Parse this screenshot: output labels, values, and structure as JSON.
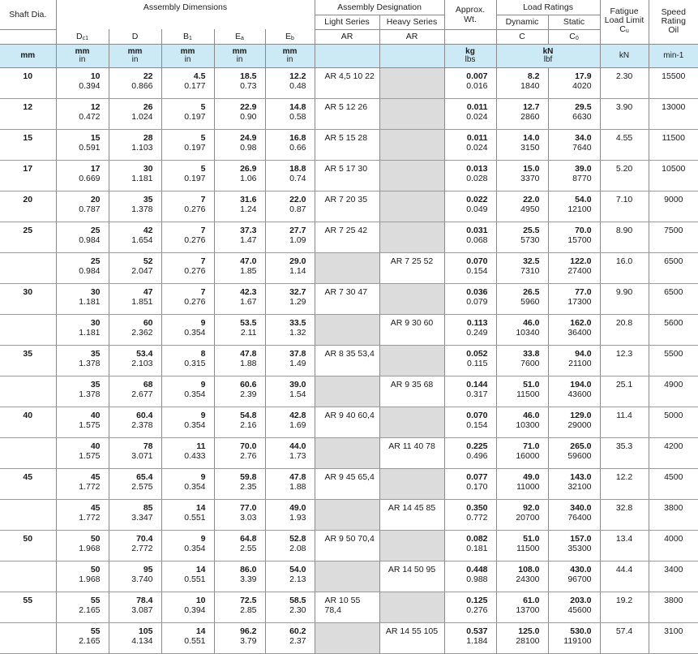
{
  "headers": {
    "shaft_dia": "Shaft Dia.",
    "assembly_dimensions": "Assembly Dimensions",
    "assembly_designation": "Assembly Designation",
    "light_series": "Light Series",
    "heavy_series": "Heavy Series",
    "approx_wt": "Approx. Wt.",
    "load_ratings": "Load Ratings",
    "dynamic": "Dynamic",
    "static": "Static",
    "fatigue_load_limit": "Fatigue Load Limit",
    "fatigue_symbol": "Cu",
    "speed_rating": "Speed Rating",
    "oil": "Oil"
  },
  "symbols": {
    "dc1": "Dc1",
    "d": "D",
    "b1": "B1",
    "ea": "Ea",
    "eb": "Eb",
    "ar_light": "AR",
    "ar_heavy": "AR",
    "c": "C",
    "c0": "C0"
  },
  "units": {
    "shaft": "mm",
    "dim_metric": "mm",
    "dim_inch": "in",
    "wt_metric": "kg",
    "wt_imperial": "lbs",
    "load_metric": "kN",
    "load_imperial": "lbf",
    "fatigue": "kN",
    "speed": "min-1"
  },
  "rows": [
    {
      "shaft": "10",
      "dc1": [
        "10",
        "0.394"
      ],
      "d": [
        "22",
        "0.866"
      ],
      "b1": [
        "4.5",
        "0.177"
      ],
      "ea": [
        "18.5",
        "0.73"
      ],
      "eb": [
        "12.2",
        "0.48"
      ],
      "light": "AR 4,5 10 22",
      "heavy": "",
      "wt": [
        "0.007",
        "0.016"
      ],
      "c": [
        "8.2",
        "1840"
      ],
      "c0": [
        "17.9",
        "4020"
      ],
      "cu": "2.30",
      "speed": "15500"
    },
    {
      "shaft": "12",
      "dc1": [
        "12",
        "0.472"
      ],
      "d": [
        "26",
        "1.024"
      ],
      "b1": [
        "5",
        "0.197"
      ],
      "ea": [
        "22.9",
        "0.90"
      ],
      "eb": [
        "14.8",
        "0.58"
      ],
      "light": "AR 5 12 26",
      "heavy": "",
      "wt": [
        "0.011",
        "0.024"
      ],
      "c": [
        "12.7",
        "2860"
      ],
      "c0": [
        "29.5",
        "6630"
      ],
      "cu": "3.90",
      "speed": "13000"
    },
    {
      "shaft": "15",
      "dc1": [
        "15",
        "0.591"
      ],
      "d": [
        "28",
        "1.103"
      ],
      "b1": [
        "5",
        "0.197"
      ],
      "ea": [
        "24.9",
        "0.98"
      ],
      "eb": [
        "16.8",
        "0.66"
      ],
      "light": "AR 5 15 28",
      "heavy": "",
      "wt": [
        "0.011",
        "0.024"
      ],
      "c": [
        "14.0",
        "3150"
      ],
      "c0": [
        "34.0",
        "7640"
      ],
      "cu": "4.55",
      "speed": "11500"
    },
    {
      "shaft": "17",
      "dc1": [
        "17",
        "0.669"
      ],
      "d": [
        "30",
        "1.181"
      ],
      "b1": [
        "5",
        "0.197"
      ],
      "ea": [
        "26.9",
        "1.06"
      ],
      "eb": [
        "18.8",
        "0.74"
      ],
      "light": "AR 5 17 30",
      "heavy": "",
      "wt": [
        "0.013",
        "0.028"
      ],
      "c": [
        "15.0",
        "3370"
      ],
      "c0": [
        "39.0",
        "8770"
      ],
      "cu": "5.20",
      "speed": "10500"
    },
    {
      "shaft": "20",
      "dc1": [
        "20",
        "0.787"
      ],
      "d": [
        "35",
        "1.378"
      ],
      "b1": [
        "7",
        "0.276"
      ],
      "ea": [
        "31.6",
        "1.24"
      ],
      "eb": [
        "22.0",
        "0.87"
      ],
      "light": "AR 7 20 35",
      "heavy": "",
      "wt": [
        "0.022",
        "0.049"
      ],
      "c": [
        "22.0",
        "4950"
      ],
      "c0": [
        "54.0",
        "12100"
      ],
      "cu": "7.10",
      "speed": "9000"
    },
    {
      "shaft": "25",
      "dc1": [
        "25",
        "0.984"
      ],
      "d": [
        "42",
        "1.654"
      ],
      "b1": [
        "7",
        "0.276"
      ],
      "ea": [
        "37.3",
        "1.47"
      ],
      "eb": [
        "27.7",
        "1.09"
      ],
      "light": "AR 7 25 42",
      "heavy": "",
      "wt": [
        "0.031",
        "0.068"
      ],
      "c": [
        "25.5",
        "5730"
      ],
      "c0": [
        "70.0",
        "15700"
      ],
      "cu": "8.90",
      "speed": "7500"
    },
    {
      "shaft": "",
      "dc1": [
        "25",
        "0.984"
      ],
      "d": [
        "52",
        "2.047"
      ],
      "b1": [
        "7",
        "0.276"
      ],
      "ea": [
        "47.0",
        "1.85"
      ],
      "eb": [
        "29.0",
        "1.14"
      ],
      "light": "",
      "heavy": "AR 7 25 52",
      "wt": [
        "0.070",
        "0.154"
      ],
      "c": [
        "32.5",
        "7310"
      ],
      "c0": [
        "122.0",
        "27400"
      ],
      "cu": "16.0",
      "speed": "6500"
    },
    {
      "shaft": "30",
      "dc1": [
        "30",
        "1.181"
      ],
      "d": [
        "47",
        "1.851"
      ],
      "b1": [
        "7",
        "0.276"
      ],
      "ea": [
        "42.3",
        "1.67"
      ],
      "eb": [
        "32.7",
        "1.29"
      ],
      "light": "AR 7 30 47",
      "heavy": "",
      "wt": [
        "0.036",
        "0.079"
      ],
      "c": [
        "26.5",
        "5960"
      ],
      "c0": [
        "77.0",
        "17300"
      ],
      "cu": "9.90",
      "speed": "6500"
    },
    {
      "shaft": "",
      "dc1": [
        "30",
        "1.181"
      ],
      "d": [
        "60",
        "2.362"
      ],
      "b1": [
        "9",
        "0.354"
      ],
      "ea": [
        "53.5",
        "2.11"
      ],
      "eb": [
        "33.5",
        "1.32"
      ],
      "light": "",
      "heavy": "AR 9 30 60",
      "wt": [
        "0.113",
        "0.249"
      ],
      "c": [
        "46.0",
        "10340"
      ],
      "c0": [
        "162.0",
        "36400"
      ],
      "cu": "20.8",
      "speed": "5600"
    },
    {
      "shaft": "35",
      "dc1": [
        "35",
        "1.378"
      ],
      "d": [
        "53.4",
        "2.103"
      ],
      "b1": [
        "8",
        "0.315"
      ],
      "ea": [
        "47.8",
        "1.88"
      ],
      "eb": [
        "37.8",
        "1.49"
      ],
      "light": "AR 8 35 53,4",
      "heavy": "",
      "wt": [
        "0.052",
        "0.115"
      ],
      "c": [
        "33.8",
        "7600"
      ],
      "c0": [
        "94.0",
        "21100"
      ],
      "cu": "12.3",
      "speed": "5500"
    },
    {
      "shaft": "",
      "dc1": [
        "35",
        "1.378"
      ],
      "d": [
        "68",
        "2.677"
      ],
      "b1": [
        "9",
        "0.354"
      ],
      "ea": [
        "60.6",
        "2.39"
      ],
      "eb": [
        "39.0",
        "1.54"
      ],
      "light": "",
      "heavy": "AR 9 35 68",
      "wt": [
        "0.144",
        "0.317"
      ],
      "c": [
        "51.0",
        "11500"
      ],
      "c0": [
        "194.0",
        "43600"
      ],
      "cu": "25.1",
      "speed": "4900"
    },
    {
      "shaft": "40",
      "dc1": [
        "40",
        "1.575"
      ],
      "d": [
        "60.4",
        "2.378"
      ],
      "b1": [
        "9",
        "0.354"
      ],
      "ea": [
        "54.8",
        "2.16"
      ],
      "eb": [
        "42.8",
        "1.69"
      ],
      "light": "AR 9 40 60,4",
      "heavy": "",
      "wt": [
        "0.070",
        "0.154"
      ],
      "c": [
        "46.0",
        "10300"
      ],
      "c0": [
        "129.0",
        "29000"
      ],
      "cu": "11.4",
      "speed": "5000"
    },
    {
      "shaft": "",
      "dc1": [
        "40",
        "1.575"
      ],
      "d": [
        "78",
        "3.071"
      ],
      "b1": [
        "11",
        "0.433"
      ],
      "ea": [
        "70.0",
        "2.76"
      ],
      "eb": [
        "44.0",
        "1.73"
      ],
      "light": "",
      "heavy": "AR 11 40 78",
      "wt": [
        "0.225",
        "0.496"
      ],
      "c": [
        "71.0",
        "16000"
      ],
      "c0": [
        "265.0",
        "59600"
      ],
      "cu": "35.3",
      "speed": "4200"
    },
    {
      "shaft": "45",
      "dc1": [
        "45",
        "1.772"
      ],
      "d": [
        "65.4",
        "2.575"
      ],
      "b1": [
        "9",
        "0.354"
      ],
      "ea": [
        "59.8",
        "2.35"
      ],
      "eb": [
        "47.8",
        "1.88"
      ],
      "light": "AR 9 45 65,4",
      "heavy": "",
      "wt": [
        "0.077",
        "0.170"
      ],
      "c": [
        "49.0",
        "11000"
      ],
      "c0": [
        "143.0",
        "32100"
      ],
      "cu": "12.2",
      "speed": "4500"
    },
    {
      "shaft": "",
      "dc1": [
        "45",
        "1.772"
      ],
      "d": [
        "85",
        "3.347"
      ],
      "b1": [
        "14",
        "0.551"
      ],
      "ea": [
        "77.0",
        "3.03"
      ],
      "eb": [
        "49.0",
        "1.93"
      ],
      "light": "",
      "heavy": "AR 14 45 85",
      "wt": [
        "0.350",
        "0.772"
      ],
      "c": [
        "92.0",
        "20700"
      ],
      "c0": [
        "340.0",
        "76400"
      ],
      "cu": "32.8",
      "speed": "3800"
    },
    {
      "shaft": "50",
      "dc1": [
        "50",
        "1.968"
      ],
      "d": [
        "70.4",
        "2.772"
      ],
      "b1": [
        "9",
        "0.354"
      ],
      "ea": [
        "64.8",
        "2.55"
      ],
      "eb": [
        "52.8",
        "2.08"
      ],
      "light": "AR 9 50 70,4",
      "heavy": "",
      "wt": [
        "0.082",
        "0.181"
      ],
      "c": [
        "51.0",
        "11500"
      ],
      "c0": [
        "157.0",
        "35300"
      ],
      "cu": "13.4",
      "speed": "4000"
    },
    {
      "shaft": "",
      "dc1": [
        "50",
        "1.968"
      ],
      "d": [
        "95",
        "3.740"
      ],
      "b1": [
        "14",
        "0.551"
      ],
      "ea": [
        "86.0",
        "3.39"
      ],
      "eb": [
        "54.0",
        "2.13"
      ],
      "light": "",
      "heavy": "AR 14 50 95",
      "wt": [
        "0.448",
        "0.988"
      ],
      "c": [
        "108.0",
        "24300"
      ],
      "c0": [
        "430.0",
        "96700"
      ],
      "cu": "44.4",
      "speed": "3400"
    },
    {
      "shaft": "55",
      "dc1": [
        "55",
        "2.165"
      ],
      "d": [
        "78.4",
        "3.087"
      ],
      "b1": [
        "10",
        "0.394"
      ],
      "ea": [
        "72.5",
        "2.85"
      ],
      "eb": [
        "58.5",
        "2.30"
      ],
      "light": "AR 10 55 78,4",
      "heavy": "",
      "wt": [
        "0.125",
        "0.276"
      ],
      "c": [
        "61.0",
        "13700"
      ],
      "c0": [
        "203.0",
        "45600"
      ],
      "cu": "19.2",
      "speed": "3800"
    },
    {
      "shaft": "",
      "dc1": [
        "55",
        "2.165"
      ],
      "d": [
        "105",
        "4.134"
      ],
      "b1": [
        "14",
        "0.551"
      ],
      "ea": [
        "96.2",
        "3.79"
      ],
      "eb": [
        "60.2",
        "2.37"
      ],
      "light": "",
      "heavy": "AR 14 55 105",
      "wt": [
        "0.537",
        "1.184"
      ],
      "c": [
        "125.0",
        "28100"
      ],
      "c0": [
        "530.0",
        "119100"
      ],
      "cu": "57.4",
      "speed": "3100"
    }
  ]
}
